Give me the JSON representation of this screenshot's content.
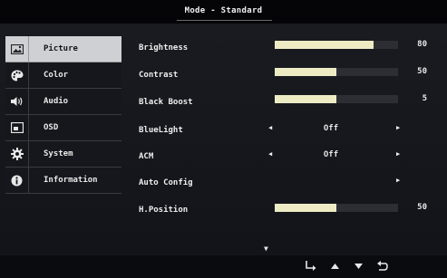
{
  "header": {
    "title": "Mode - Standard"
  },
  "sidebar": {
    "items": [
      {
        "label": "Picture",
        "icon": "picture-icon",
        "active": true
      },
      {
        "label": "Color",
        "icon": "palette-icon",
        "active": false
      },
      {
        "label": "Audio",
        "icon": "speaker-icon",
        "active": false
      },
      {
        "label": "OSD",
        "icon": "screen-icon",
        "active": false
      },
      {
        "label": "System",
        "icon": "gear-icon",
        "active": false
      },
      {
        "label": "Information",
        "icon": "info-icon",
        "active": false
      }
    ]
  },
  "settings": {
    "brightness": {
      "label": "Brightness",
      "value": "80",
      "level": 0.8
    },
    "contrast": {
      "label": "Contrast",
      "value": "50",
      "level": 0.5
    },
    "black_boost": {
      "label": "Black Boost",
      "value": "5",
      "level": 0.5
    },
    "blue_light": {
      "label": "BlueLight",
      "value": "Off"
    },
    "acm": {
      "label": "ACM",
      "value": "Off"
    },
    "auto_config": {
      "label": "Auto Config"
    },
    "h_position": {
      "label": "H.Position",
      "value": "50",
      "level": 0.5
    }
  },
  "footer": {
    "buttons": [
      "enter-icon",
      "up-arrow-icon",
      "down-arrow-icon",
      "back-icon"
    ]
  },
  "colors": {
    "bar_fill": "#ecebc4",
    "active_bg": "#cfd0d4",
    "background": "#121318"
  }
}
